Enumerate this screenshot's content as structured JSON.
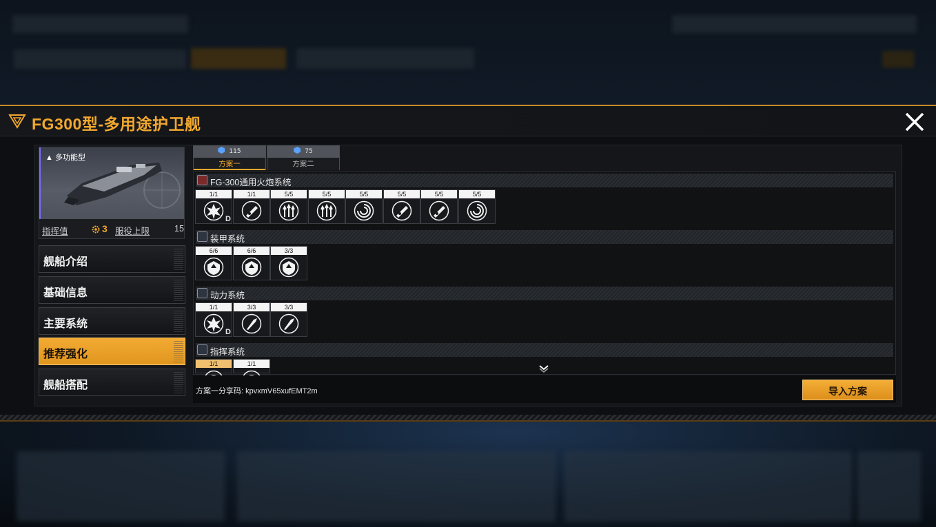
{
  "header": {
    "title": "FG300型-多用途护卫舰"
  },
  "ship": {
    "type_label": "多功能型",
    "command_label": "指挥值",
    "command_value": "3",
    "service_label": "服役上限",
    "service_value": "15"
  },
  "nav": [
    {
      "label": "舰船介绍",
      "active": false
    },
    {
      "label": "基础信息",
      "active": false
    },
    {
      "label": "主要系统",
      "active": false
    },
    {
      "label": "推荐强化",
      "active": true
    },
    {
      "label": "舰船搭配",
      "active": false
    }
  ],
  "plans": [
    {
      "cost": "115",
      "label": "方案一",
      "active": true
    },
    {
      "cost": "75",
      "label": "方案二",
      "active": false
    }
  ],
  "sections": [
    {
      "title": "FG-300通用火炮系统",
      "icon": "cannon-system-icon",
      "slots": [
        {
          "count": "1/1",
          "icon": "burst-upgrade-icon",
          "mark": "D"
        },
        {
          "count": "1/1",
          "icon": "cannon-upgrade-icon",
          "mark": ""
        },
        {
          "count": "5/5",
          "icon": "triple-arrow-up-icon",
          "mark": ""
        },
        {
          "count": "5/5",
          "icon": "triple-arrow-up-icon",
          "mark": ""
        },
        {
          "count": "5/5",
          "icon": "target-swirl-icon",
          "mark": ""
        },
        {
          "count": "5/5",
          "icon": "cannon-swirl-icon",
          "mark": ""
        },
        {
          "count": "5/5",
          "icon": "cannon-swirl-icon",
          "mark": ""
        },
        {
          "count": "5/5",
          "icon": "target-swirl-icon",
          "mark": ""
        }
      ]
    },
    {
      "title": "装甲系统",
      "icon": "armor-system-icon",
      "slots": [
        {
          "count": "6/6",
          "icon": "shield-up-icon",
          "mark": ""
        },
        {
          "count": "6/6",
          "icon": "shield-up-icon",
          "mark": ""
        },
        {
          "count": "3/3",
          "icon": "shield-arrow-icon",
          "mark": ""
        }
      ]
    },
    {
      "title": "动力系统",
      "icon": "engine-system-icon",
      "slots": [
        {
          "count": "1/1",
          "icon": "burst-upgrade-icon",
          "mark": "D"
        },
        {
          "count": "3/3",
          "icon": "thruster-icon",
          "mark": ""
        },
        {
          "count": "3/3",
          "icon": "thruster-turn-icon",
          "mark": ""
        }
      ]
    },
    {
      "title": "指挥系统",
      "icon": "command-system-icon",
      "slots": [
        {
          "count": "1/1",
          "icon": "command-upgrade-icon",
          "mark": ""
        },
        {
          "count": "1/1",
          "icon": "command-upgrade-icon",
          "mark": ""
        }
      ]
    }
  ],
  "footer": {
    "share_label": "方案一分享码: kpvxmV65xufEMT2m",
    "import_label": "导入方案"
  },
  "colors": {
    "accent": "#f2a82e",
    "panel": "#141619",
    "active_nav": "#e99f25"
  }
}
